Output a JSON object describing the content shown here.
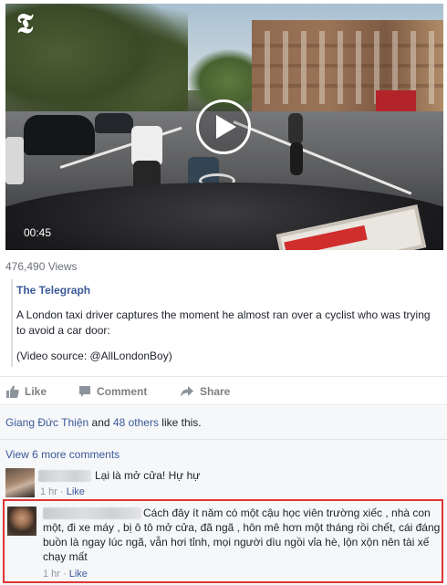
{
  "video": {
    "duration": "00:45",
    "views": "476,490 Views",
    "logo_glyph": "𝕿"
  },
  "attachment": {
    "source_title": "The Telegraph",
    "description": "A London taxi driver captures the moment he almost ran over a cyclist who was trying to avoid a car door:",
    "credit": "(Video source: @AllLondonBoy)"
  },
  "actions": {
    "like": "Like",
    "comment": "Comment",
    "share": "Share"
  },
  "likes": {
    "name": "Giang Đức Thiện",
    "and": " and ",
    "others": "48 others",
    "suffix": " like this."
  },
  "comments": {
    "view_more": "View 6 more comments",
    "items": [
      {
        "text": "Lại là mở cửa! Hự hự",
        "time": "1 hr",
        "separator": " · ",
        "like": "Like"
      },
      {
        "text": "Cách đây ít năm có một cậu học viên trường xiếc , nhà con một, đi xe máy , bị ô tô mở cửa, đã ngã , hôn mê hơn một tháng rồi chết, cái đáng buồn là ngay lúc ngã, vẫn hơi tỉnh, mọi người dìu ngồi vỉa hè, lộn xộn nên tài xế chạy mất",
        "time": "1 hr",
        "separator": " · ",
        "like": "Like"
      }
    ]
  },
  "colors": {
    "link": "#3b5998",
    "highlight_border": "#e03434",
    "action_gray": "#7f7f7f"
  },
  "icons": {
    "play": "play-icon",
    "like": "thumbs-up-icon",
    "comment": "speech-bubble-icon",
    "share": "share-arrow-icon"
  }
}
